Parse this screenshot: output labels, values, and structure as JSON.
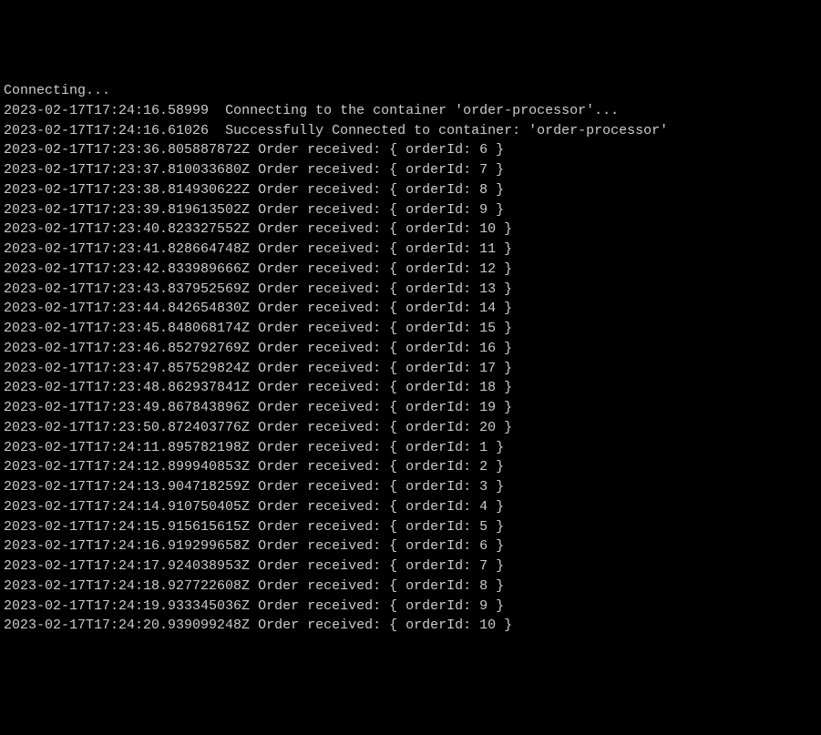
{
  "header": {
    "connecting": "Connecting...",
    "line1_ts": "2023-02-17T17:24:16.58999",
    "line1_msg": "Connecting to the container 'order-processor'...",
    "line2_ts": "2023-02-17T17:24:16.61026",
    "line2_msg": "Successfully Connected to container: 'order-processor'"
  },
  "logs": [
    {
      "ts": "2023-02-17T17:23:36.805887872Z",
      "msg": "Order received: { orderId: 6 }"
    },
    {
      "ts": "2023-02-17T17:23:37.810033680Z",
      "msg": "Order received: { orderId: 7 }"
    },
    {
      "ts": "2023-02-17T17:23:38.814930622Z",
      "msg": "Order received: { orderId: 8 }"
    },
    {
      "ts": "2023-02-17T17:23:39.819613502Z",
      "msg": "Order received: { orderId: 9 }"
    },
    {
      "ts": "2023-02-17T17:23:40.823327552Z",
      "msg": "Order received: { orderId: 10 }"
    },
    {
      "ts": "2023-02-17T17:23:41.828664748Z",
      "msg": "Order received: { orderId: 11 }"
    },
    {
      "ts": "2023-02-17T17:23:42.833989666Z",
      "msg": "Order received: { orderId: 12 }"
    },
    {
      "ts": "2023-02-17T17:23:43.837952569Z",
      "msg": "Order received: { orderId: 13 }"
    },
    {
      "ts": "2023-02-17T17:23:44.842654830Z",
      "msg": "Order received: { orderId: 14 }"
    },
    {
      "ts": "2023-02-17T17:23:45.848068174Z",
      "msg": "Order received: { orderId: 15 }"
    },
    {
      "ts": "2023-02-17T17:23:46.852792769Z",
      "msg": "Order received: { orderId: 16 }"
    },
    {
      "ts": "2023-02-17T17:23:47.857529824Z",
      "msg": "Order received: { orderId: 17 }"
    },
    {
      "ts": "2023-02-17T17:23:48.862937841Z",
      "msg": "Order received: { orderId: 18 }"
    },
    {
      "ts": "2023-02-17T17:23:49.867843896Z",
      "msg": "Order received: { orderId: 19 }"
    },
    {
      "ts": "2023-02-17T17:23:50.872403776Z",
      "msg": "Order received: { orderId: 20 }"
    },
    {
      "ts": "2023-02-17T17:24:11.895782198Z",
      "msg": "Order received: { orderId: 1 }"
    },
    {
      "ts": "2023-02-17T17:24:12.899940853Z",
      "msg": "Order received: { orderId: 2 }"
    },
    {
      "ts": "2023-02-17T17:24:13.904718259Z",
      "msg": "Order received: { orderId: 3 }"
    },
    {
      "ts": "2023-02-17T17:24:14.910750405Z",
      "msg": "Order received: { orderId: 4 }"
    },
    {
      "ts": "2023-02-17T17:24:15.915615615Z",
      "msg": "Order received: { orderId: 5 }"
    },
    {
      "ts": "2023-02-17T17:24:16.919299658Z",
      "msg": "Order received: { orderId: 6 }"
    },
    {
      "ts": "2023-02-17T17:24:17.924038953Z",
      "msg": "Order received: { orderId: 7 }"
    },
    {
      "ts": "2023-02-17T17:24:18.927722608Z",
      "msg": "Order received: { orderId: 8 }"
    },
    {
      "ts": "2023-02-17T17:24:19.933345036Z",
      "msg": "Order received: { orderId: 9 }"
    },
    {
      "ts": "2023-02-17T17:24:20.939099248Z",
      "msg": "Order received: { orderId: 10 }"
    }
  ]
}
